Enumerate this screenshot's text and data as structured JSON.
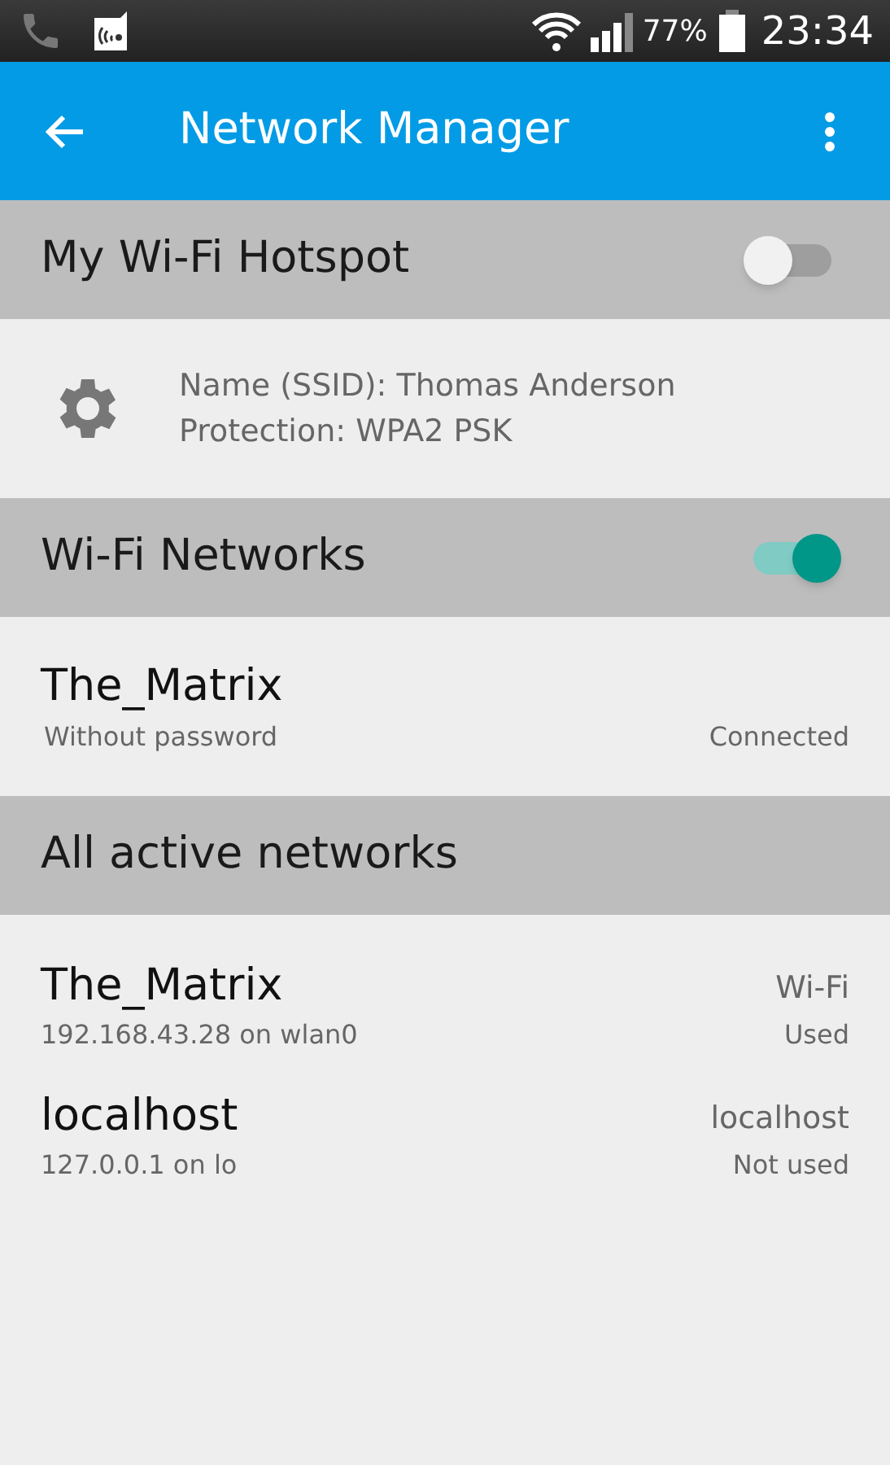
{
  "status_bar": {
    "battery": "77%",
    "time": "23:34"
  },
  "app_bar": {
    "title": "Network Manager"
  },
  "hotspot": {
    "title": "My Wi-Fi Hotspot",
    "on": false,
    "info": [
      "Name (SSID): Thomas Anderson",
      "Protection: WPA2 PSK"
    ]
  },
  "wifi": {
    "title": "Wi-Fi Networks",
    "on": true,
    "networks": [
      {
        "name": "The_Matrix",
        "security": "Without password",
        "status": "Connected"
      }
    ]
  },
  "active": {
    "title": "All active networks",
    "items": [
      {
        "name": "The_Matrix",
        "address": "192.168.43.28 on wlan0",
        "type": "Wi-Fi",
        "usage": "Used"
      },
      {
        "name": "localhost",
        "address": "127.0.0.1 on lo",
        "type": "localhost",
        "usage": "Not used"
      }
    ]
  }
}
